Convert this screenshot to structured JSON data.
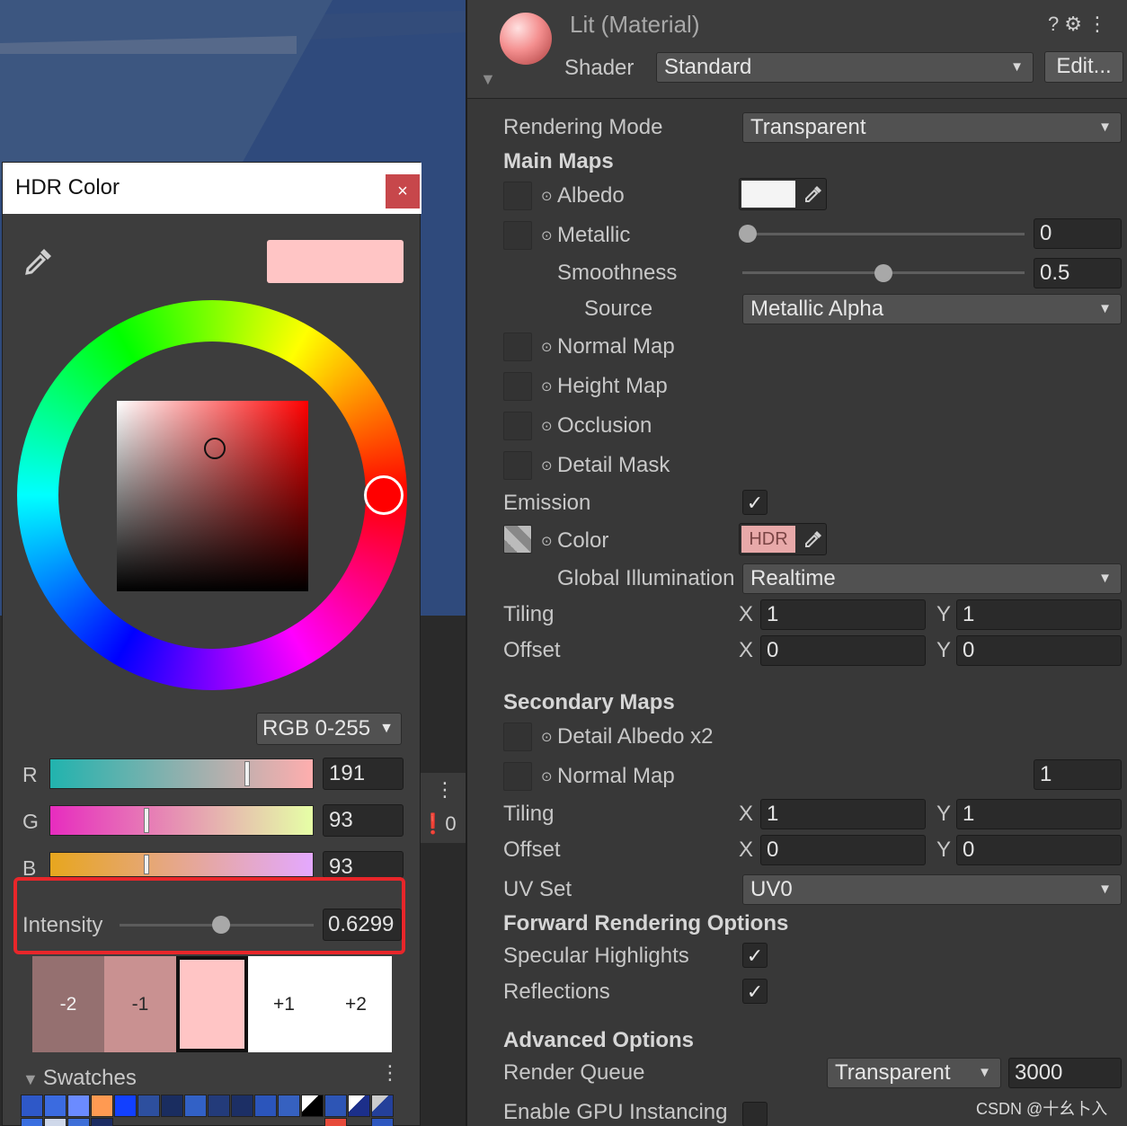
{
  "hdr_picker": {
    "title": "HDR Color",
    "close_label": "×",
    "preview_color": "#ffc5c5",
    "mode": "RGB 0-255",
    "channels": [
      {
        "label": "R",
        "value": "191",
        "fraction": 0.749
      },
      {
        "label": "G",
        "value": "93",
        "fraction": 0.365
      },
      {
        "label": "B",
        "value": "93",
        "fraction": 0.365
      }
    ],
    "intensity": {
      "label": "Intensity",
      "value": "0.6299",
      "fraction": 0.53
    },
    "stops": [
      "-2",
      "-1",
      "",
      "+1",
      "+2"
    ],
    "swatches_title": "Swatches"
  },
  "scene": {
    "warn_count": "0"
  },
  "inspector": {
    "material_title": "Lit (Material)",
    "shader_label": "Shader",
    "shader_value": "Standard",
    "edit_label": "Edit...",
    "rendering_mode_label": "Rendering Mode",
    "rendering_mode_value": "Transparent",
    "main_maps_title": "Main Maps",
    "albedo_label": "Albedo",
    "metallic_label": "Metallic",
    "metallic_value": "0",
    "smoothness_label": "Smoothness",
    "smoothness_value": "0.5",
    "source_label": "Source",
    "source_value": "Metallic Alpha",
    "normal_map_label": "Normal Map",
    "height_map_label": "Height Map",
    "occlusion_label": "Occlusion",
    "detail_mask_label": "Detail Mask",
    "emission_label": "Emission",
    "color_label": "Color",
    "hdr_badge": "HDR",
    "emission_color": "#e8a9a9",
    "gi_label": "Global Illumination",
    "gi_value": "Realtime",
    "tiling_label": "Tiling",
    "offset_label": "Offset",
    "x_label": "X",
    "y_label": "Y",
    "main_tiling": {
      "x": "1",
      "y": "1"
    },
    "main_offset": {
      "x": "0",
      "y": "0"
    },
    "secondary_maps_title": "Secondary Maps",
    "detail_albedo_label": "Detail Albedo x2",
    "normal_map2_label": "Normal Map",
    "normal_map2_value": "1",
    "sec_tiling": {
      "x": "1",
      "y": "1"
    },
    "sec_offset": {
      "x": "0",
      "y": "0"
    },
    "uv_set_label": "UV Set",
    "uv_set_value": "UV0",
    "forward_title": "Forward Rendering Options",
    "specular_label": "Specular Highlights",
    "reflections_label": "Reflections",
    "advanced_title": "Advanced Options",
    "render_queue_label": "Render Queue",
    "render_queue_mode": "Transparent",
    "render_queue_value": "3000",
    "gpu_instancing_label": "Enable GPU Instancing"
  },
  "watermark": "CSDN @十幺卜入"
}
